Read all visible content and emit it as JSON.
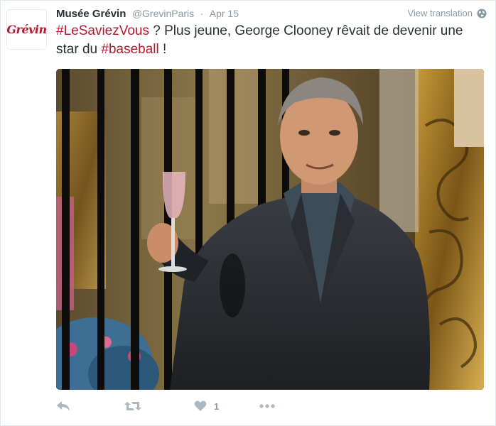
{
  "tweet": {
    "author_name": "Musée Grévin",
    "author_handle": "@GrevinParis",
    "separator": "·",
    "date": "Apr 15",
    "view_translation": "View translation",
    "avatar_logo": "Grévin",
    "text_parts": {
      "hashtag1": "#LeSaviezVous",
      "text1": " ? Plus jeune, George Clooney rêvait de devenir une star du ",
      "hashtag2": "#baseball",
      "text2": " !"
    },
    "media_description_icon": "photo",
    "actions": {
      "reply_icon": "reply-icon",
      "retweet_icon": "retweet-icon",
      "like_icon": "heart-icon",
      "like_count": "1",
      "more_icon": "more-icon"
    }
  },
  "colors": {
    "hashtag": "#b8182e",
    "text": "#292f33",
    "muted": "#8899a6",
    "action": "#aab8c2"
  }
}
